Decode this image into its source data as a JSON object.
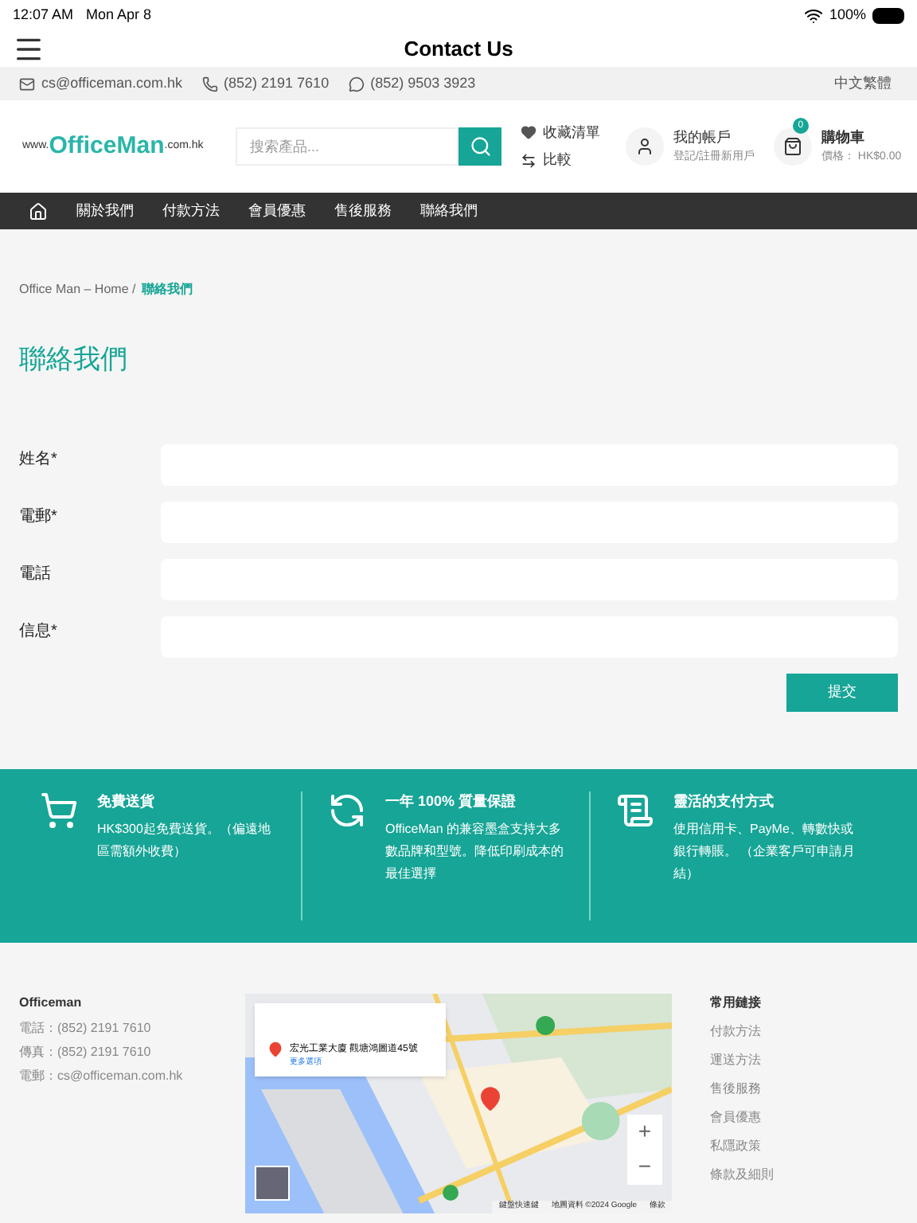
{
  "status_bar": {
    "time": "12:07 AM",
    "date": "Mon Apr 8",
    "battery": "100%"
  },
  "app_bar": {
    "title": "Contact Us"
  },
  "contact_bar": {
    "email": "cs@officeman.com.hk",
    "phone": "(852) 2191 7610",
    "whatsapp": "(852) 9503 3923",
    "language": "中文繁體"
  },
  "header": {
    "logo": {
      "prefix": "www.",
      "name": "OfficeMan",
      "suffix": ".com.hk"
    },
    "search": {
      "placeholder": "搜索產品..."
    },
    "wishlist": "收藏清單",
    "compare": "比較",
    "account": {
      "title": "我的帳戶",
      "subtitle": "登記/註冊新用戶"
    },
    "cart": {
      "count": "0",
      "title": "購物車",
      "subtitle": "價格： HK$0.00"
    }
  },
  "nav": {
    "items": [
      "關於我們",
      "付款方法",
      "會員優惠",
      "售後服務",
      "聯絡我們"
    ]
  },
  "breadcrumb": {
    "trail": "Office Man – Home /",
    "current": "聯絡我們"
  },
  "heading": "聯絡我們",
  "form": {
    "fields": [
      {
        "label": "姓名*"
      },
      {
        "label": "電郵*"
      },
      {
        "label": "電話"
      },
      {
        "label": "信息*"
      }
    ],
    "submit": "提交"
  },
  "features": [
    {
      "kind": "cart",
      "title": "免費送貨",
      "text": "HK$300起免費送貨。（偏遠地區需額外收費）"
    },
    {
      "kind": "refund",
      "title": "一年 100% 質量保證",
      "text": "OfficeMan 的兼容墨盒支持大多數品牌和型號。降低印刷成本的最佳選擇"
    },
    {
      "kind": "receipt",
      "title": "靈活的支付方式",
      "text": "使用信用卡、PayMe、轉數快或銀行轉賬。 （企業客戶可申請月結）"
    }
  ],
  "footer": {
    "company": "Officeman",
    "lines": [
      "電話：(852) 2191 7610",
      "傳真：(852) 2191 7610",
      "電郵：cs@officeman.com.hk"
    ],
    "map": {
      "kind": "picture",
      "place": "宏光工業大廈 觀塘鴻圖道45號",
      "more": "更多選項",
      "zoom_in": "+",
      "zoom_out": "−",
      "attribution": [
        "鍵盤快速鍵",
        "地圖資料 ©2024 Google",
        "條款"
      ]
    },
    "links_title": "常用鏈接",
    "links": [
      "付款方法",
      "運送方法",
      "售後服務",
      "會員優惠",
      "私隱政策",
      "條款及細則"
    ]
  }
}
